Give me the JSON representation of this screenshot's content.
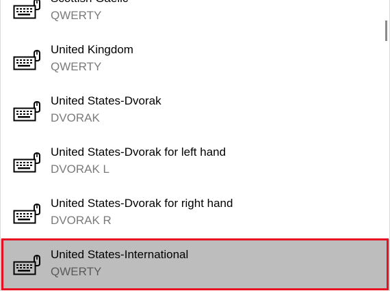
{
  "layouts": [
    {
      "name": "Scottish Gaelic",
      "layout": "QWERTY",
      "icon": "keyboard-icon",
      "selected": false
    },
    {
      "name": "United Kingdom",
      "layout": "QWERTY",
      "icon": "keyboard-icon",
      "selected": false
    },
    {
      "name": "United States-Dvorak",
      "layout": "DVORAK",
      "icon": "keyboard-icon",
      "selected": false
    },
    {
      "name": "United States-Dvorak for left hand",
      "layout": "DVORAK L",
      "icon": "keyboard-icon",
      "selected": false
    },
    {
      "name": "United States-Dvorak for right hand",
      "layout": "DVORAK R",
      "icon": "keyboard-icon",
      "selected": false
    },
    {
      "name": "United States-International",
      "layout": "QWERTY",
      "icon": "keyboard-icon",
      "selected": true
    }
  ],
  "colors": {
    "selection_background": "#bdbdbd",
    "selection_border": "#e81123",
    "secondary_text": "#7a7a7a"
  }
}
